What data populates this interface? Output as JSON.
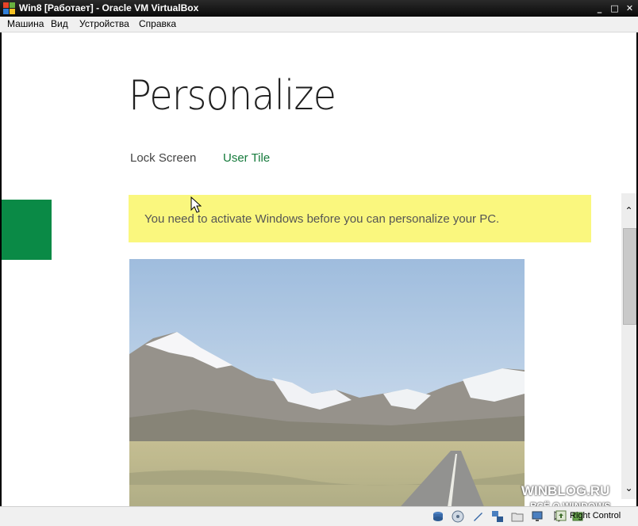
{
  "window": {
    "title": "Win8 [Работает] - Oracle VM VirtualBox",
    "controls": {
      "minimize": "_",
      "maximize": "□",
      "close": "✕"
    }
  },
  "menu": {
    "items": [
      {
        "label": "Машина"
      },
      {
        "label": "Вид"
      },
      {
        "label": "Устройства"
      },
      {
        "label": "Справка"
      }
    ]
  },
  "page": {
    "heading": "Personalize",
    "tabs": [
      {
        "label": "Lock Screen",
        "active": false
      },
      {
        "label": "User Tile",
        "active": true
      }
    ],
    "banner": "You need to activate Windows before you can personalize your PC."
  },
  "colors": {
    "accent": "#0a8a46",
    "tab_active": "#157a3b",
    "banner_bg": "#faf77e"
  },
  "scrollbar": {
    "up": "⌃",
    "down": "⌄"
  },
  "watermark": {
    "line1": "WINBLOG.RU",
    "line2": "ВСЁ О WINDOWS"
  },
  "status": {
    "icons": [
      "hdd-icon",
      "cd-icon",
      "usb-icon",
      "network-icon",
      "shared-folder-icon",
      "display-icon",
      "mouse-icon",
      "vrdp-icon"
    ],
    "host_key": "Right Control"
  }
}
